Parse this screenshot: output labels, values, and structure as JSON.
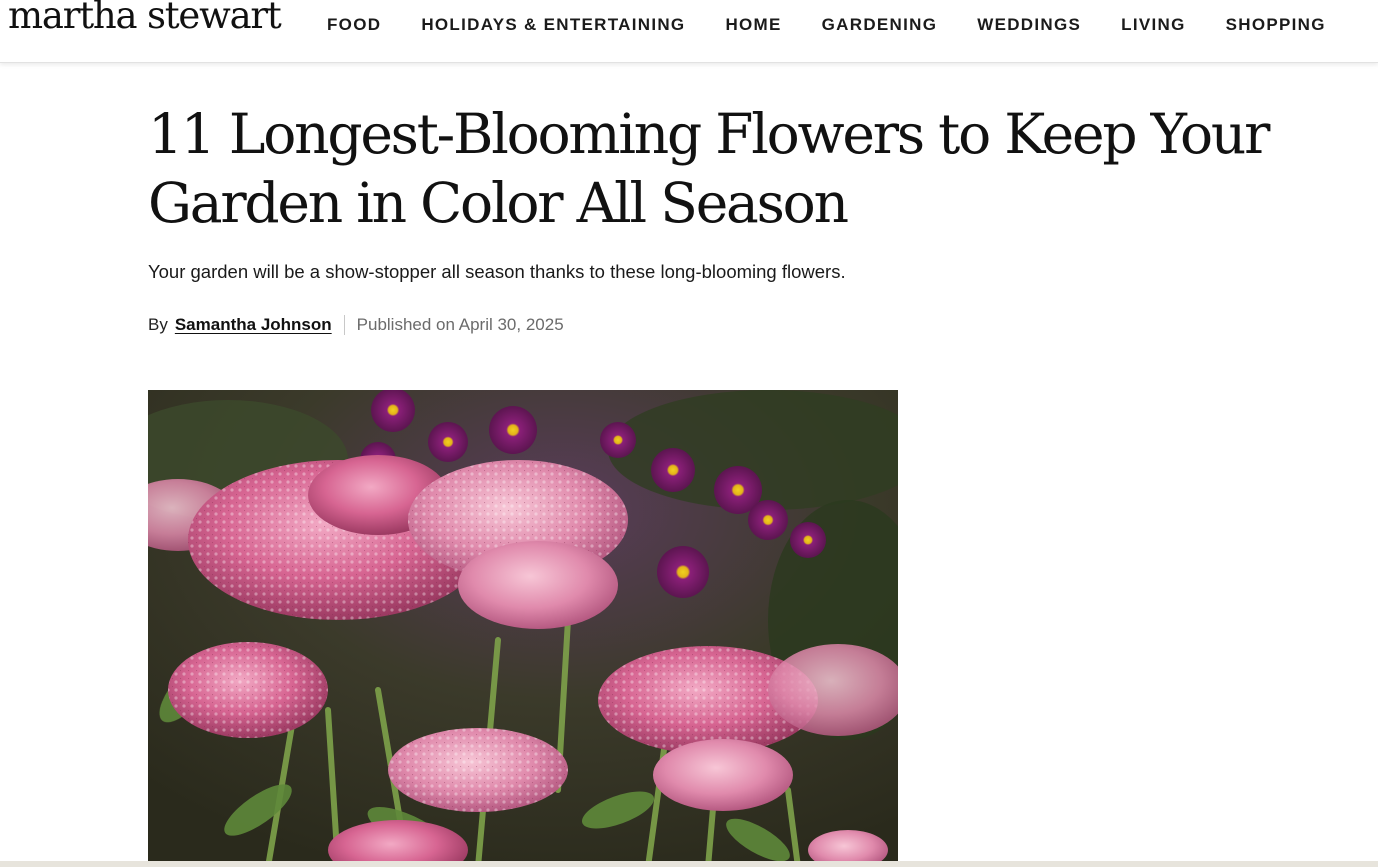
{
  "header": {
    "logo": "martha stewart",
    "nav": [
      {
        "label": "FOOD"
      },
      {
        "label": "HOLIDAYS & ENTERTAINING"
      },
      {
        "label": "HOME"
      },
      {
        "label": "GARDENING"
      },
      {
        "label": "WEDDINGS"
      },
      {
        "label": "LIVING"
      },
      {
        "label": "SHOPPING"
      }
    ]
  },
  "article": {
    "title": "11 Longest-Blooming Flowers to Keep Your Garden in Color All Season",
    "dek": "Your garden will be a show-stopper all season thanks to these long-blooming flowers.",
    "byline": {
      "prefix": "By",
      "author": "Samantha Johnson",
      "published": "Published on April 30, 2025"
    }
  },
  "colors": {
    "text": "#111111",
    "muted": "#6b6b6b",
    "divider": "#c8c8c8"
  }
}
